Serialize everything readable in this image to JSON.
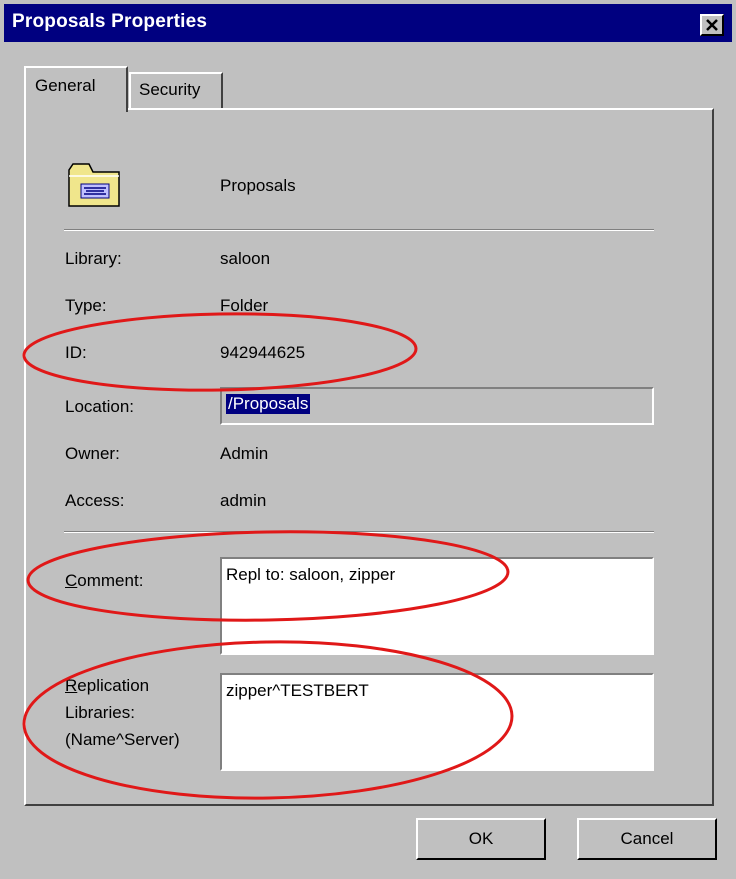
{
  "window": {
    "title": "Proposals Properties"
  },
  "tabs": [
    {
      "label": "General",
      "active": true
    },
    {
      "label": "Security",
      "active": false
    }
  ],
  "header": {
    "icon": "folder-icon",
    "name": "Proposals"
  },
  "properties": {
    "library": {
      "label": "Library:",
      "value": "saloon"
    },
    "type": {
      "label": "Type:",
      "value": "Folder"
    },
    "id": {
      "label": "ID:",
      "value": "942944625"
    },
    "location": {
      "label": "Location:",
      "value": "/Proposals"
    },
    "owner": {
      "label": "Owner:",
      "value": "Admin"
    },
    "access": {
      "label": "Access:",
      "value": "admin"
    }
  },
  "comment": {
    "label_mnemonic": "C",
    "label_rest": "omment:",
    "value": "Repl to: saloon, zipper"
  },
  "replication": {
    "label_mnemonic": "R",
    "label_line1_rest": "eplication",
    "label_line2": "Libraries:",
    "label_line3": "(Name^Server)",
    "value": "zipper^TESTBERT"
  },
  "buttons": {
    "ok": "OK",
    "cancel": "Cancel"
  },
  "colors": {
    "titlebar": "#000080",
    "face": "#c0c0c0",
    "annotation": "#e01818"
  }
}
